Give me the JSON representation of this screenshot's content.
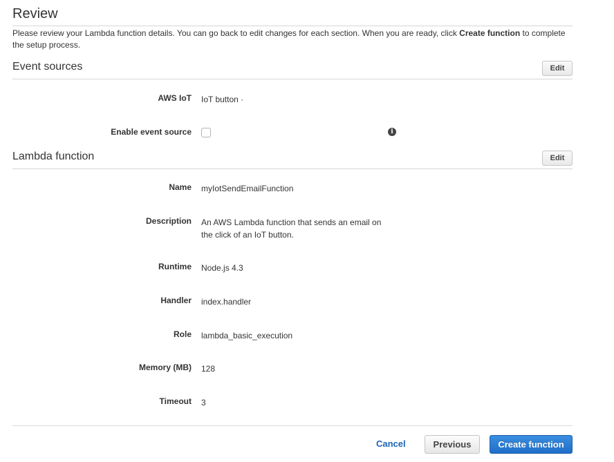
{
  "page": {
    "title": "Review",
    "intro_before": "Please review your Lambda function details. You can go back to edit changes for each section. When you are ready, click ",
    "intro_bold": "Create function",
    "intro_after": " to complete the setup process."
  },
  "event_sources": {
    "title": "Event sources",
    "edit_label": "Edit",
    "rows": [
      {
        "label": "AWS IoT",
        "value": "IoT button ·"
      },
      {
        "label": "Enable event source",
        "checked": false,
        "info_icon": "info-circle-icon"
      }
    ]
  },
  "lambda_function": {
    "title": "Lambda function",
    "edit_label": "Edit",
    "rows": [
      {
        "label": "Name",
        "value": "myIotSendEmailFunction"
      },
      {
        "label": "Description",
        "value": "An AWS Lambda function that sends an email on the click of an IoT button."
      },
      {
        "label": "Runtime",
        "value": "Node.js 4.3"
      },
      {
        "label": "Handler",
        "value": "index.handler"
      },
      {
        "label": "Role",
        "value": "lambda_basic_execution"
      },
      {
        "label": "Memory (MB)",
        "value": "128"
      },
      {
        "label": "Timeout",
        "value": "3"
      }
    ]
  },
  "footer": {
    "cancel_label": "Cancel",
    "previous_label": "Previous",
    "create_label": "Create function"
  },
  "colors": {
    "primary_button": "#1f6ec9",
    "link": "#1e64b4",
    "divider": "#d5d5d5"
  }
}
